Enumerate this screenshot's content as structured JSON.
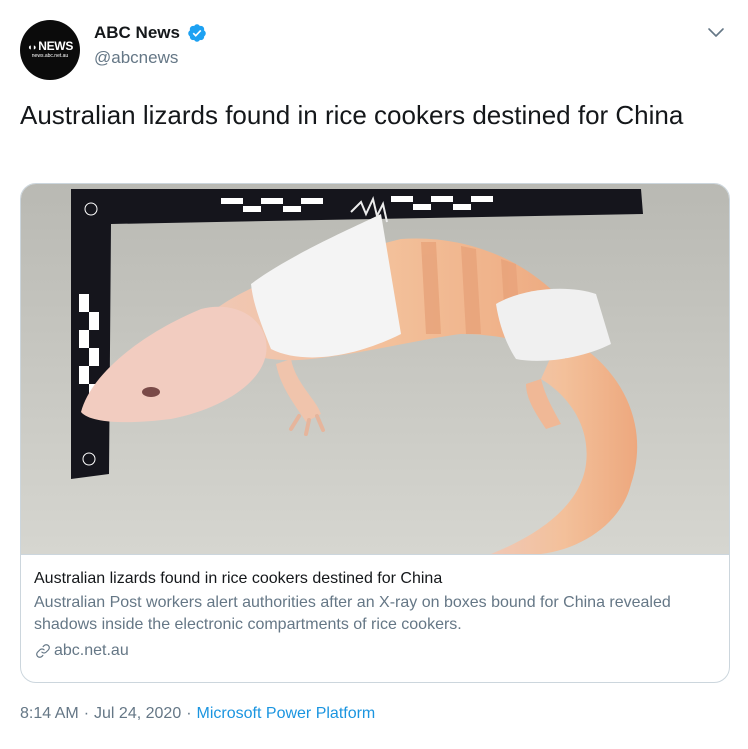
{
  "account": {
    "display_name": "ABC News",
    "handle": "@abcnews",
    "avatar_logo": "NEWS",
    "avatar_url": "news.abc.net.au",
    "verified": true
  },
  "tweet": {
    "text": "Australian lizards found in rice cookers destined for China"
  },
  "card": {
    "image_name": "lizard-photo",
    "title": "Australian lizards found in rice cookers destined for China",
    "description": "Australian Post workers alert authorities after an X-ray on boxes bound for China revealed shadows inside the electronic compartments of rice cookers.",
    "domain": "abc.net.au"
  },
  "meta": {
    "time": "8:14 AM",
    "date": "Jul 24, 2020",
    "separator": "·",
    "source": "Microsoft Power Platform"
  },
  "colors": {
    "verified_blue": "#1da1f2",
    "link_blue": "#1b95e0",
    "secondary_text": "#657786"
  },
  "icons": [
    "verified-icon",
    "chevron-down-icon",
    "link-icon"
  ]
}
